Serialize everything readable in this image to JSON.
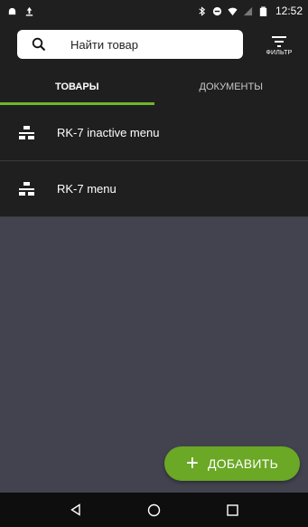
{
  "status_bar": {
    "time": "12:52"
  },
  "search": {
    "placeholder": "Найти товар"
  },
  "filter": {
    "label": "ФИЛЬТР"
  },
  "tabs": [
    {
      "label": "ТОВАРЫ",
      "active": true
    },
    {
      "label": "ДОКУМЕНТЫ",
      "active": false
    }
  ],
  "items": [
    {
      "label": "RK-7 inactive menu",
      "icon": "menu-hierarchy-icon"
    },
    {
      "label": "RK-7 menu",
      "icon": "menu-hierarchy-icon"
    }
  ],
  "fab": {
    "label": "ДОБАВИТЬ",
    "icon": "plus-icon"
  },
  "colors": {
    "accent": "#6aa825",
    "bar": "#1f1f1f",
    "content_bg": "#434350"
  }
}
